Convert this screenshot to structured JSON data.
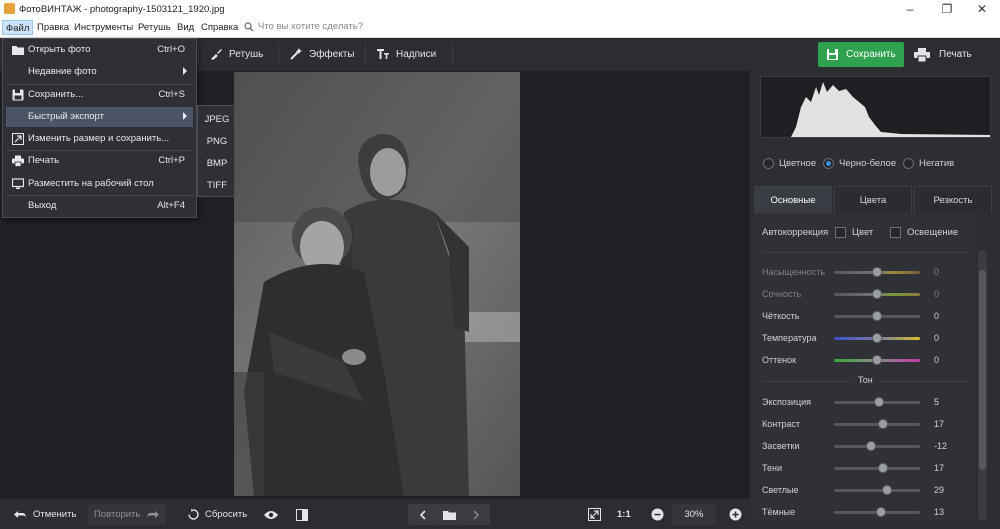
{
  "window": {
    "title": "ФотоВИНТАЖ - photography-1503121_1920.jpg"
  },
  "menubar": {
    "items": [
      "Файл",
      "Правка",
      "Инструменты",
      "Ретушь",
      "Вид",
      "Справка"
    ],
    "search_placeholder": "Что вы хотите сделать?"
  },
  "toolbar": {
    "retouch": "Ретушь",
    "effects": "Эффекты",
    "captions": "Надписи",
    "save": "Сохранить",
    "print": "Печать"
  },
  "file_menu": {
    "open": {
      "label": "Открыть фото",
      "shortcut": "Ctrl+O"
    },
    "recent": {
      "label": "Недавние фото"
    },
    "save": {
      "label": "Сохранить...",
      "shortcut": "Ctrl+S"
    },
    "quick_export": {
      "label": "Быстрый экспорт"
    },
    "resize_save": {
      "label": "Изменить размер и сохранить..."
    },
    "print": {
      "label": "Печать",
      "shortcut": "Ctrl+P"
    },
    "desktop": {
      "label": "Разместить на рабочий стол"
    },
    "exit": {
      "label": "Выход",
      "shortcut": "Alt+F4"
    }
  },
  "export_submenu": [
    "JPEG",
    "PNG",
    "BMP",
    "TIFF"
  ],
  "mode": {
    "options": [
      "Цветное",
      "Черно-белое",
      "Негатив"
    ],
    "selected": "Черно-белое"
  },
  "panel_tabs": {
    "items": [
      "Основные",
      "Цвета",
      "Резкость"
    ],
    "active": "Основные"
  },
  "autocorrection": {
    "label": "Автокоррекция",
    "color": "Цвет",
    "light": "Освещение"
  },
  "sliders": [
    {
      "label": "Насыщенность",
      "value": "0",
      "enabled": false
    },
    {
      "label": "Сочность",
      "value": "0",
      "enabled": false
    },
    {
      "label": "Чёткость",
      "value": "0",
      "enabled": true
    },
    {
      "label": "Температура",
      "value": "0",
      "enabled": true
    },
    {
      "label": "Оттенок",
      "value": "0",
      "enabled": true
    }
  ],
  "tone": {
    "header": "Тон",
    "sliders": [
      {
        "label": "Экспозиция",
        "value": "5"
      },
      {
        "label": "Контраст",
        "value": "17"
      },
      {
        "label": "Засветки",
        "value": "-12"
      },
      {
        "label": "Тени",
        "value": "17"
      },
      {
        "label": "Светлые",
        "value": "29"
      },
      {
        "label": "Тёмные",
        "value": "13"
      }
    ]
  },
  "bottombar": {
    "undo": "Отменить",
    "redo": "Повторить",
    "reset": "Сбросить",
    "ratio": "1:1",
    "zoom": "30%"
  },
  "colors": {
    "accent_green": "#2ea24f",
    "selection_blue": "#3d8fe0",
    "panel_bg": "#2c2e33"
  }
}
